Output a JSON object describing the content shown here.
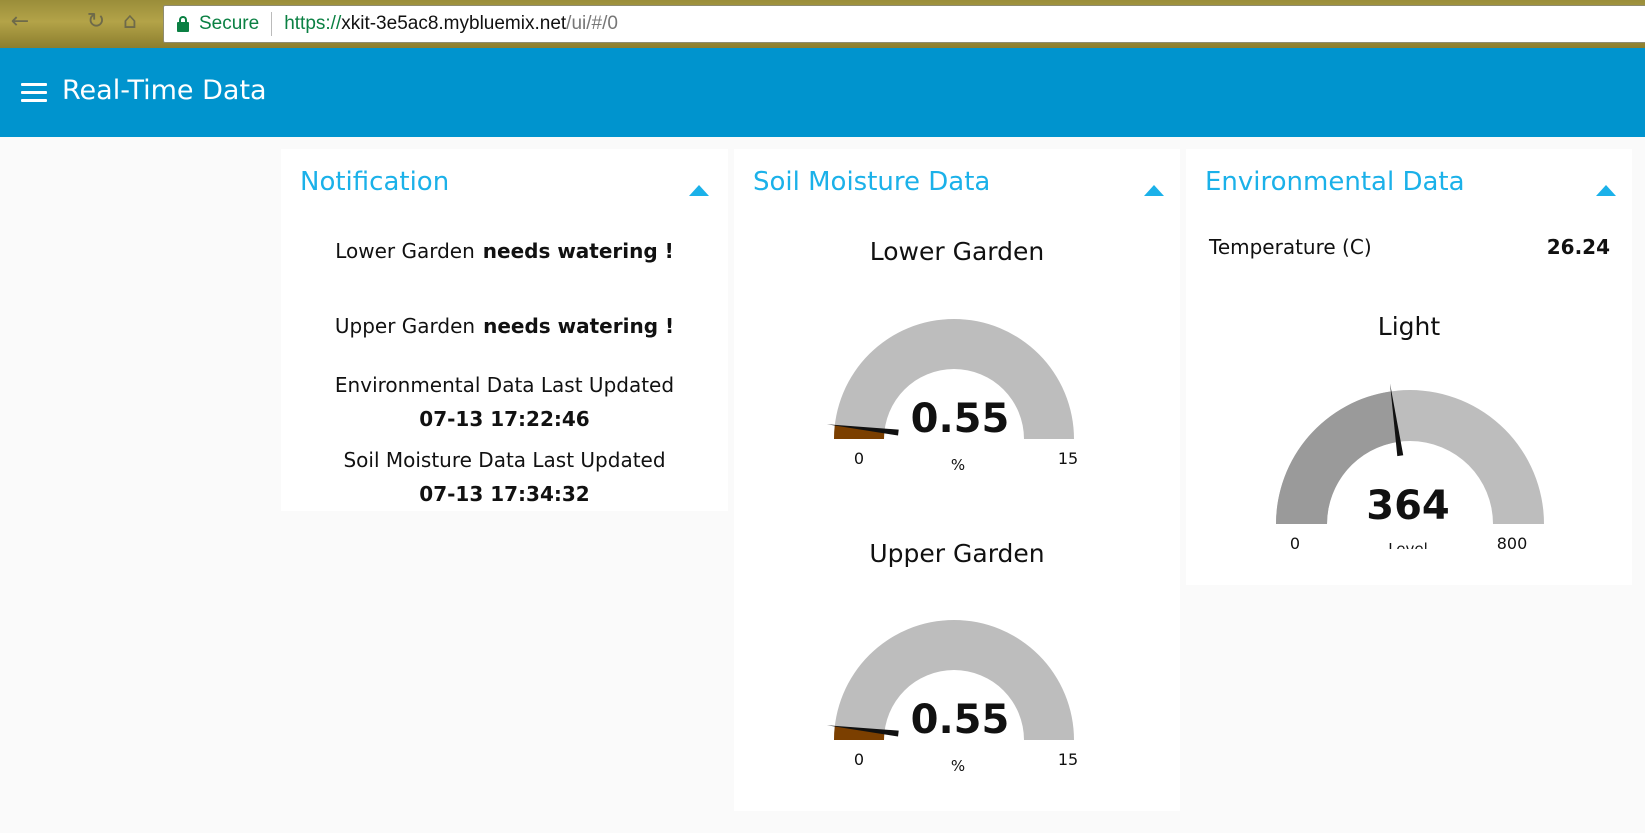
{
  "browser": {
    "secure_label": "Secure",
    "url_scheme": "https://",
    "url_host": "xkit-3e5ac8.mybluemix.net",
    "url_path": "/ui/#/0",
    "back_icon": "back-arrow-icon",
    "reload_icon": "reload-icon",
    "home_icon": "home-icon"
  },
  "header": {
    "title": "Real-Time Data",
    "menu_icon": "hamburger-menu-icon",
    "color": "#0094ce"
  },
  "accent_color": "#1bb1e9",
  "notification": {
    "title": "Notification",
    "lower": {
      "name": "Lower Garden",
      "status": "needs watering !"
    },
    "upper": {
      "name": "Upper Garden",
      "status": "needs watering !"
    },
    "env_updated_label": "Environmental Data Last Updated",
    "env_updated_value": "07-13 17:22:46",
    "soil_updated_label": "Soil Moisture Data Last Updated",
    "soil_updated_value": "07-13 17:34:32"
  },
  "soil": {
    "title": "Soil Moisture Data",
    "gauges": [
      {
        "label": "Lower Garden",
        "value": "0.55",
        "unit": "%",
        "min": "0",
        "max": "15",
        "fill_color": "#7b3f00"
      },
      {
        "label": "Upper Garden",
        "value": "0.55",
        "unit": "%",
        "min": "0",
        "max": "15",
        "fill_color": "#7b3f00"
      }
    ]
  },
  "environment": {
    "title": "Environmental Data",
    "temperature_label": "Temperature (C)",
    "temperature_value": "26.24",
    "light": {
      "label": "Light",
      "value": "364",
      "unit": "Level",
      "min": "0",
      "max": "800",
      "fill_color": "#9a9a9a"
    }
  }
}
